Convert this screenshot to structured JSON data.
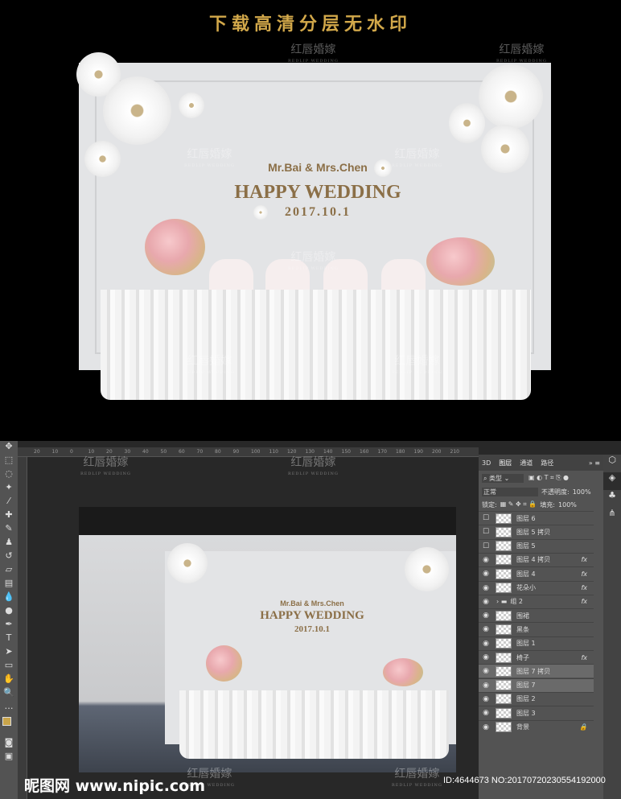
{
  "banner_title": "下载高清分层无水印",
  "watermark": {
    "cn": "红唇婚嫁",
    "en": "REDLIP WEDDING"
  },
  "backdrop": {
    "names": "Mr.Bai & Mrs.Chen",
    "headline": "HAPPY WEDDING",
    "date": "2017.10.1"
  },
  "ruler_top": [
    "20",
    "10",
    "0",
    "10",
    "20",
    "30",
    "40",
    "50",
    "60",
    "70",
    "80",
    "90",
    "100",
    "110",
    "120",
    "130",
    "140",
    "150",
    "160",
    "170",
    "180",
    "190",
    "200",
    "210"
  ],
  "layers_panel": {
    "tabs": [
      "3D",
      "图层",
      "通道",
      "路径"
    ],
    "filter_kind": "类型",
    "blend_mode": "正常",
    "opacity_label": "不透明度:",
    "opacity": "100%",
    "lock_label": "锁定:",
    "fill_label": "填充:",
    "fill": "100%",
    "layers": [
      {
        "name": "图层 6",
        "visible": false,
        "fx": ""
      },
      {
        "name": "图层 5 拷贝",
        "visible": false,
        "fx": ""
      },
      {
        "name": "图层 5",
        "visible": false,
        "fx": ""
      },
      {
        "name": "图层 4 拷贝",
        "visible": true,
        "fx": "fx"
      },
      {
        "name": "图层 4",
        "visible": true,
        "fx": "fx"
      },
      {
        "name": "花朵小",
        "visible": true,
        "fx": "fx"
      },
      {
        "name": "组 2",
        "visible": true,
        "fx": "fx",
        "group": true
      },
      {
        "name": "围裙",
        "visible": true,
        "fx": ""
      },
      {
        "name": "黑条",
        "visible": true,
        "fx": ""
      },
      {
        "name": "图层 1",
        "visible": true,
        "fx": ""
      },
      {
        "name": "椅子",
        "visible": true,
        "fx": "fx"
      },
      {
        "name": "图层 7 拷贝",
        "visible": true,
        "fx": "",
        "selected": true
      },
      {
        "name": "图层 7",
        "visible": true,
        "fx": "",
        "selected": true
      },
      {
        "name": "图层 2",
        "visible": true,
        "fx": ""
      },
      {
        "name": "图层 3",
        "visible": true,
        "fx": ""
      },
      {
        "name": "背景",
        "visible": true,
        "fx": "",
        "locked": true
      }
    ]
  },
  "footer": {
    "site": "昵图网 www.nipic.com",
    "id": "ID:4644673 NO:20170720230554192000"
  }
}
